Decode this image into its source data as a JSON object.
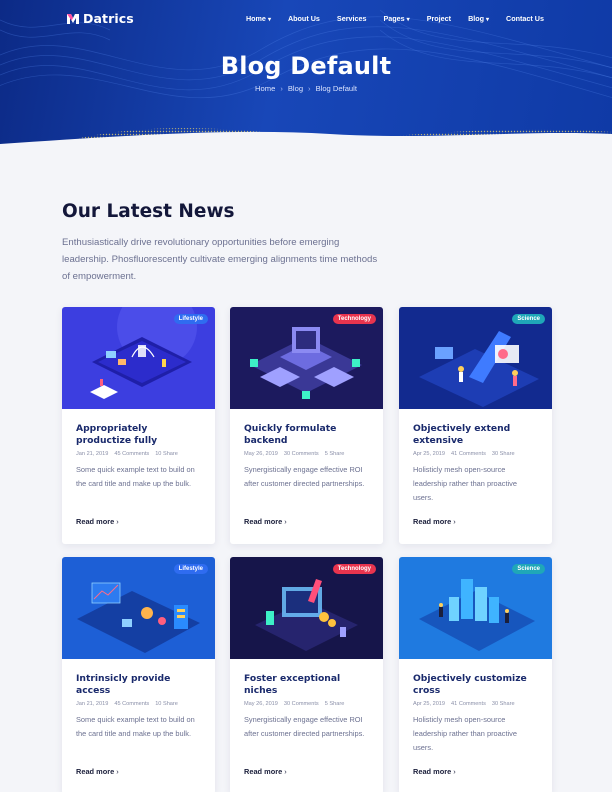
{
  "brand": {
    "name": "Datrics"
  },
  "nav": {
    "items": [
      {
        "label": "Home",
        "caret": "▾"
      },
      {
        "label": "About Us",
        "caret": ""
      },
      {
        "label": "Services",
        "caret": ""
      },
      {
        "label": "Pages",
        "caret": "▾"
      },
      {
        "label": "Project",
        "caret": ""
      },
      {
        "label": "Blog",
        "caret": "▾"
      },
      {
        "label": "Contact Us",
        "caret": ""
      }
    ]
  },
  "hero": {
    "title": "Blog Default",
    "breadcrumb": [
      "Home",
      "Blog",
      "Blog Default"
    ],
    "separator_icon": "chevron-right-icon"
  },
  "section": {
    "title": "Our Latest News",
    "description": "Enthusiastically drive revolutionary opportunities before emerging leadership. Phosfluorescently cultivate emerging alignments time methods of empowerment."
  },
  "colors": {
    "lifestyle": "#2f6cf0",
    "technology": "#e8344e",
    "science": "#1fa7b8",
    "hero_dark": "#0c2a86",
    "title_navy": "#1a2a6c"
  },
  "cards": [
    {
      "category": "Lifestyle",
      "title": "Appropriately productize fully",
      "date": "Jan 21, 2019",
      "comments": "45 Comments",
      "shares": "10 Share",
      "excerpt": "Some quick example text to build on the card title and make up the bulk.",
      "read_more": "Read more",
      "image": "isometric-office-illustration"
    },
    {
      "category": "Technology",
      "title": "Quickly formulate backend",
      "date": "May 26, 2019",
      "comments": "30 Comments",
      "shares": "5 Share",
      "excerpt": "Synergistically engage effective ROI after customer directed partnerships.",
      "read_more": "Read more",
      "image": "isometric-server-illustration"
    },
    {
      "category": "Science",
      "title": "Objectively extend extensive",
      "date": "Apr 25, 2019",
      "comments": "41 Comments",
      "shares": "30 Share",
      "excerpt": "Holisticly mesh open-source leadership rather than proactive users.",
      "read_more": "Read more",
      "image": "isometric-analytics-illustration"
    },
    {
      "category": "Lifestyle",
      "title": "Intrinsicly provide access",
      "date": "Jan 21, 2019",
      "comments": "45 Comments",
      "shares": "10 Share",
      "excerpt": "Some quick example text to build on the card title and make up the bulk.",
      "read_more": "Read more",
      "image": "isometric-dashboard-illustration"
    },
    {
      "category": "Technology",
      "title": "Foster exceptional niches",
      "date": "May 26, 2019",
      "comments": "30 Comments",
      "shares": "5 Share",
      "excerpt": "Synergistically engage effective ROI after customer directed partnerships.",
      "read_more": "Read more",
      "image": "isometric-rocket-illustration"
    },
    {
      "category": "Science",
      "title": "Objectively customize cross",
      "date": "Apr 25, 2019",
      "comments": "41 Comments",
      "shares": "30 Share",
      "excerpt": "Holisticly mesh open-source leadership rather than proactive users.",
      "read_more": "Read more",
      "image": "isometric-city-illustration"
    }
  ]
}
